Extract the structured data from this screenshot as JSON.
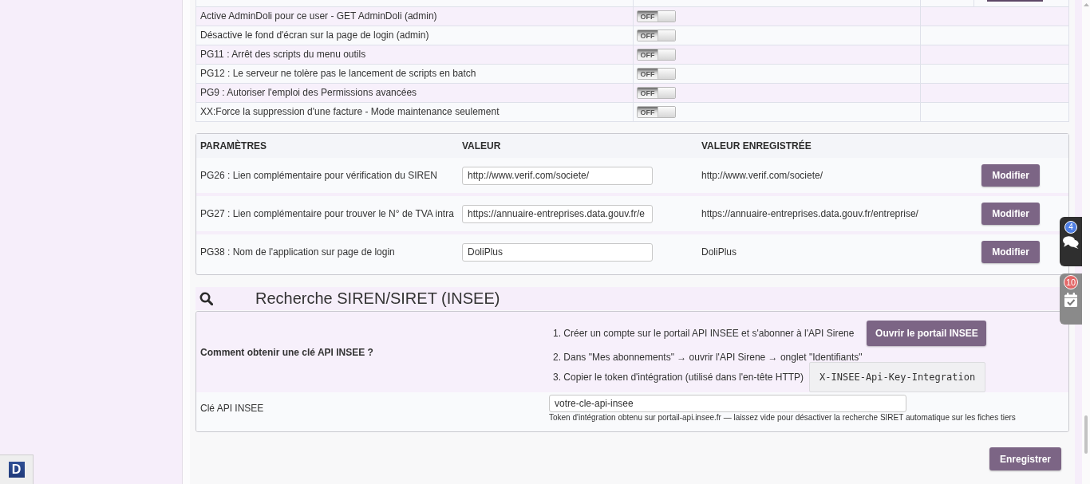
{
  "sidebar": {
    "logo": "D"
  },
  "options_table": {
    "rows": [
      {
        "label": "Active AdminDoli pour ce user - GET AdminDoli (admin)",
        "switch": {
          "on": false,
          "label": "OFF"
        }
      },
      {
        "label": "Désactive le fond d'écran sur la page de login (admin)",
        "switch": {
          "on": false,
          "label": "OFF"
        }
      },
      {
        "label": "PG11 : Arrêt des scripts du menu outils",
        "switch": {
          "on": false,
          "label": "OFF"
        }
      },
      {
        "label": "PG12 : Le serveur ne tolère pas le lancement de scripts en batch",
        "switch": {
          "on": false,
          "label": "OFF"
        }
      },
      {
        "label": "PG9 : Autoriser l'emploi des Permissions avancées",
        "switch": {
          "on": false,
          "label": "OFF"
        }
      },
      {
        "label": "XX:Force la suppression d'une facture - Mode maintenance seulement",
        "switch": {
          "on": false,
          "label": "OFF"
        }
      }
    ]
  },
  "parameters_table": {
    "columns": [
      "PARAMÈTRES",
      "VALEUR",
      "VALEUR ENREGISTRÉE"
    ],
    "rows": [
      {
        "label": "PG26 : Lien complémentaire pour vérification du SIREN",
        "value": "http://www.verif.com/societe/",
        "saved_value": "http://www.verif.com/societe/",
        "button": "Modifier"
      },
      {
        "label": "PG27 : Lien complémentaire pour trouver le N° de TVA intra",
        "value": "https://annuaire-entreprises.data.gouv.fr/e",
        "saved_value": "https://annuaire-entreprises.data.gouv.fr/entreprise/",
        "button": "Modifier"
      },
      {
        "label": "PG38 : Nom de l'application sur page de login",
        "value": "DoliPlus",
        "saved_value": "DoliPlus",
        "button": "Modifier"
      }
    ]
  },
  "insee_section": {
    "title": "Recherche SIREN/SIRET (INSEE)",
    "help_label": "Comment obtenir une clé API INSEE ?",
    "steps": [
      {
        "number": "1.",
        "text": "Créer un compte sur le portail API INSEE et s'abonner à l'API Sirene",
        "button": "Ouvrir le portail INSEE"
      },
      {
        "number": "2.",
        "text": "Dans \"Mes abonnements\" → ouvrir l'API Sirene → onglet \"Identifiants\""
      },
      {
        "number": "3.",
        "text": "Copier le token d'intégration (utilisé dans l'en-tête HTTP)",
        "code": "X-INSEE-Api-Key-Integration"
      }
    ],
    "key_field": {
      "label": "Clé API INSEE",
      "value": "votre-cle-api-insee",
      "hint": "Token d'intégration obtenu sur portail-api.insee.fr — laissez vide pour désactiver la recherche SIRET automatique sur les fiches tiers"
    }
  },
  "save_button": "Enregistrer",
  "floating_widgets": [
    {
      "kind": "messages",
      "badge": "4",
      "color": "#4f7fe3"
    },
    {
      "kind": "tasks",
      "badge": "10",
      "color": "#e36868"
    }
  ]
}
